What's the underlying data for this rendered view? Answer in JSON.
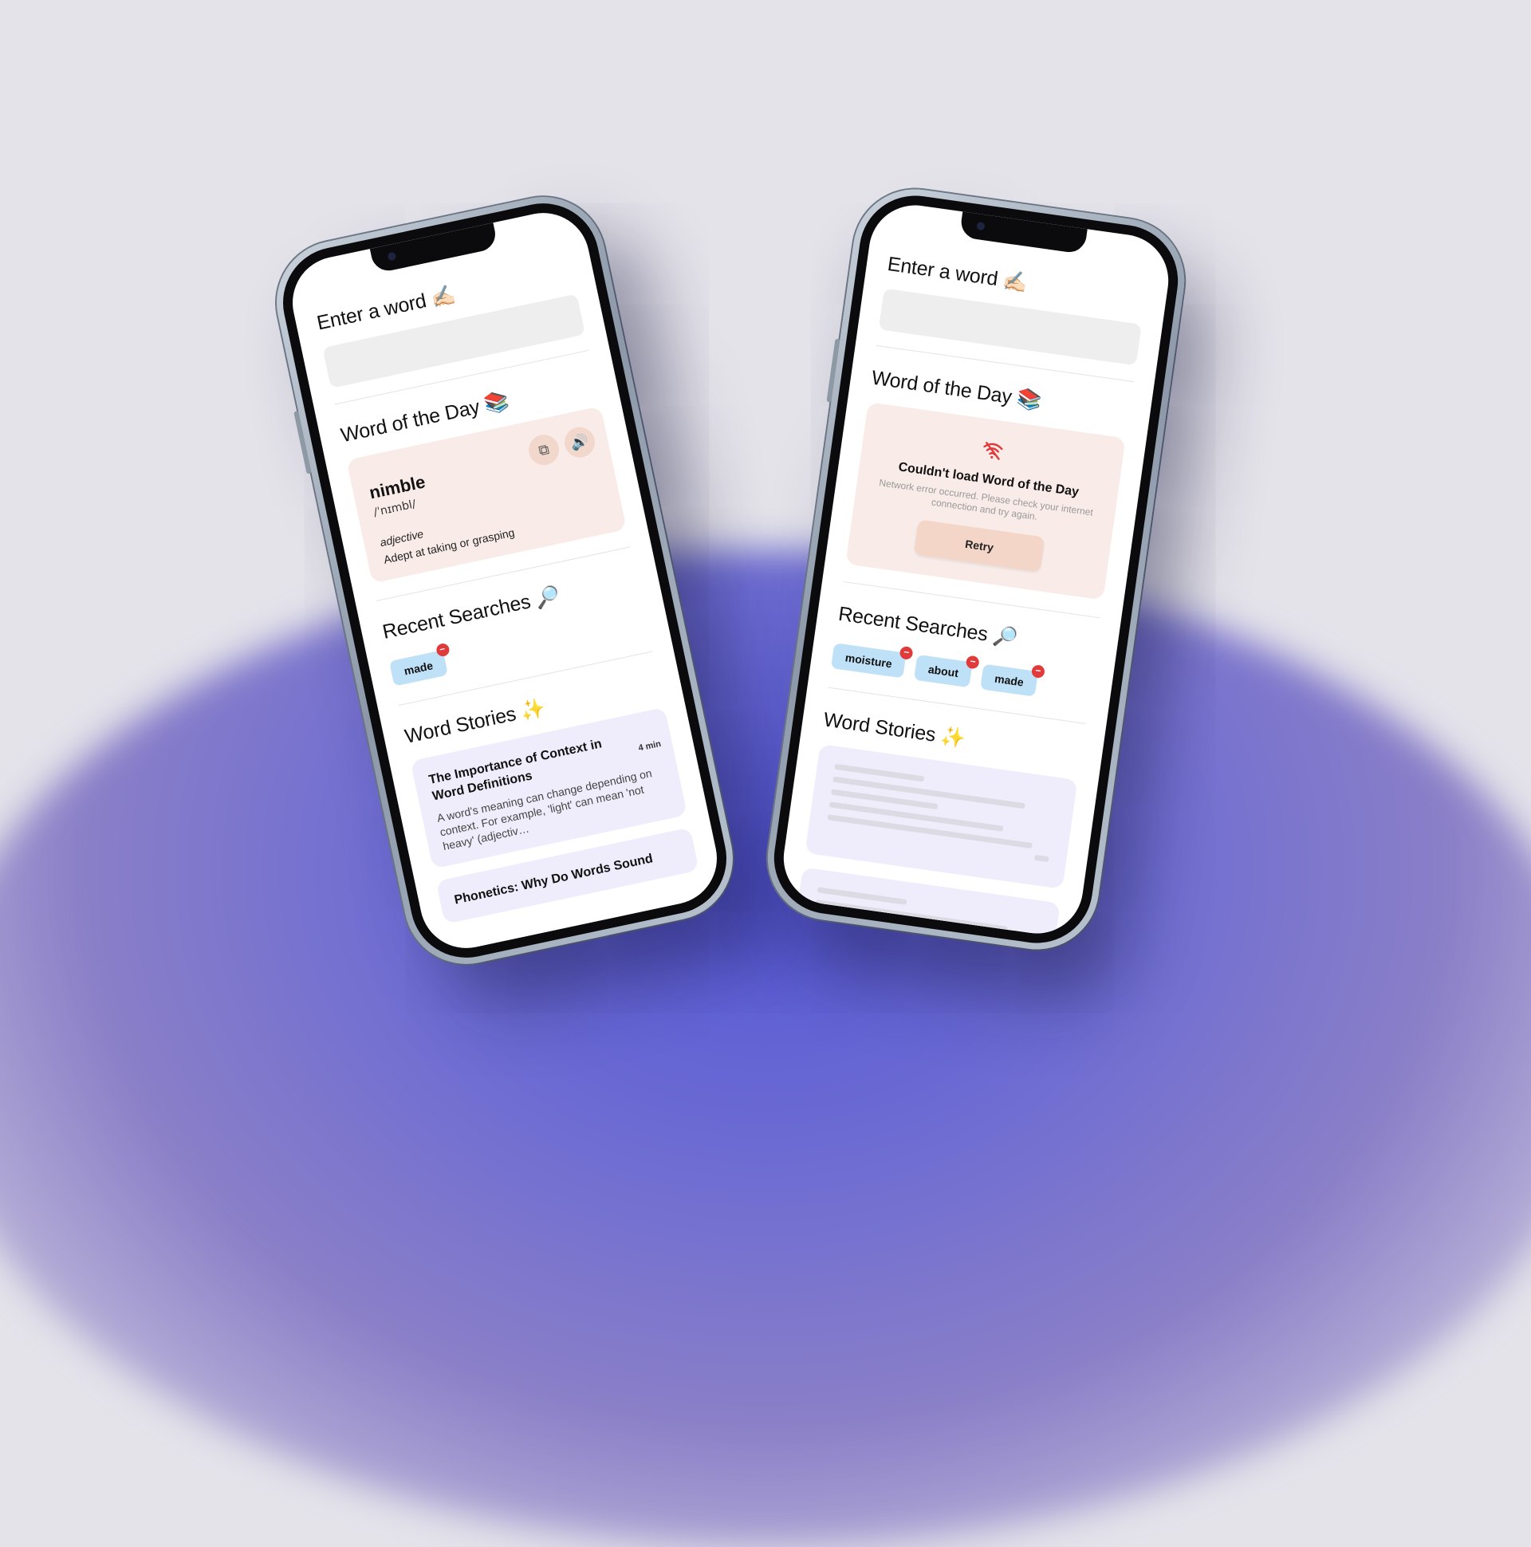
{
  "left_phone": {
    "search": {
      "heading": "Enter a word ✍🏻",
      "placeholder": ""
    },
    "word_of_day": {
      "heading": "Word of the Day 📚",
      "word": "nimble",
      "phonetic": "/ˈnɪmbl/",
      "part_of_speech": "adjective",
      "definition": "Adept at taking or grasping",
      "copy_icon": "copy-icon",
      "audio_icon": "speaker-icon"
    },
    "recent": {
      "heading": "Recent Searches 🔎",
      "items": [
        "made"
      ],
      "remove_glyph": "−"
    },
    "stories": {
      "heading": "Word Stories ✨",
      "items": [
        {
          "title": "The Importance of Context in Word Definitions",
          "time": "4 min",
          "excerpt": "A word's meaning can change depending on context. For example, 'light' can mean 'not heavy' (adjectiv…"
        },
        {
          "title": "Phonetics: Why Do Words Sound",
          "time": "",
          "excerpt": ""
        }
      ]
    }
  },
  "right_phone": {
    "search": {
      "heading": "Enter a word ✍🏻",
      "placeholder": ""
    },
    "word_of_day": {
      "heading": "Word of the Day 📚",
      "error_icon": "wifi-off-icon",
      "error_title": "Couldn't load Word of the Day",
      "error_message": "Network error occurred. Please check your internet connection and try again.",
      "retry_label": "Retry"
    },
    "recent": {
      "heading": "Recent Searches 🔎",
      "items": [
        "moisture",
        "about",
        "made"
      ],
      "remove_glyph": "−"
    },
    "stories": {
      "heading": "Word Stories ✨"
    }
  },
  "colors": {
    "background": "#e4e3ea",
    "glow": "#5456d6",
    "card_peach": "#f9ece8",
    "chip_blue": "#bfe1f8",
    "story_lavender": "#efedfb",
    "remove_red": "#e03a3a"
  }
}
